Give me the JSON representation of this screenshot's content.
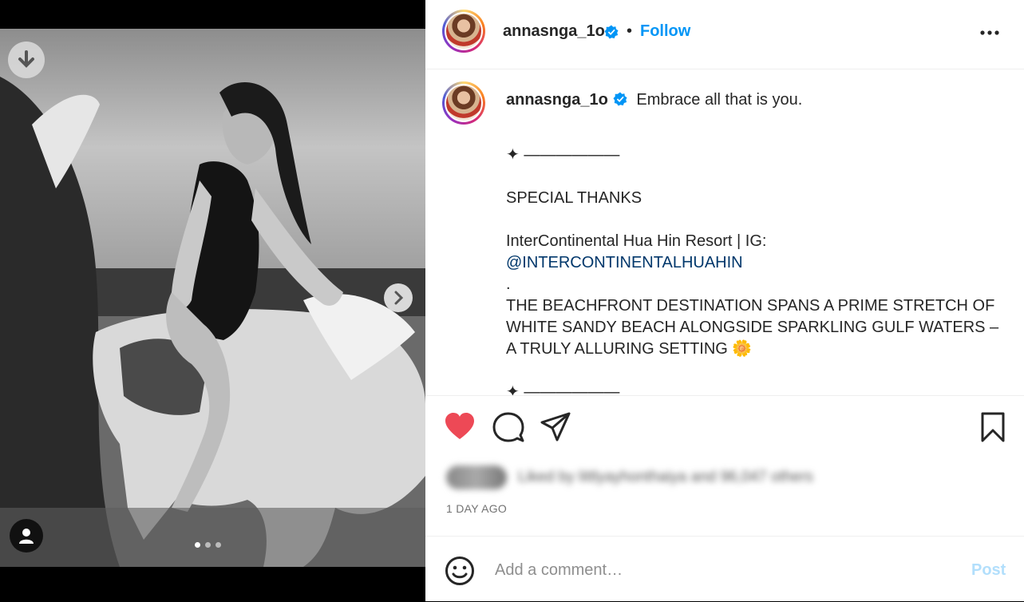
{
  "post": {
    "username": "annasnga_1o",
    "separator": "•",
    "follow_label": "Follow",
    "caption": {
      "first_line": "Embrace all that is you.",
      "divider_1": "✦ ——————",
      "special_thanks": "SPECIAL THANKS",
      "hotel_line": "InterContinental Hua Hin Resort | IG:",
      "mention": "@INTERCONTINENTALHUAHIN",
      "dot_line": ".",
      "description": "THE BEACHFRONT DESTINATION SPANS A PRIME STRETCH OF WHITE SANDY BEACH ALONGSIDE SPARKLING GULF WATERS – A TRULY ALLURING SETTING 🌼",
      "divider_2": "✦ ——————"
    },
    "likes_text": "Liked by littlyayhonthaiya and 96,047 others",
    "timestamp": "1 DAY AGO",
    "comment_placeholder": "Add a comment…",
    "post_label": "Post",
    "carousel": {
      "count": 3,
      "active": 0
    }
  },
  "colors": {
    "accent": "#0095f6",
    "like": "#ed4956",
    "post_disabled": "#b2dffc",
    "mention": "#00376b"
  },
  "icons": [
    "download-icon",
    "chevron-right-icon",
    "user-tag-icon",
    "verified-badge-icon",
    "more-options-icon",
    "heart-icon",
    "comment-icon",
    "share-icon",
    "bookmark-icon",
    "emoji-icon"
  ]
}
